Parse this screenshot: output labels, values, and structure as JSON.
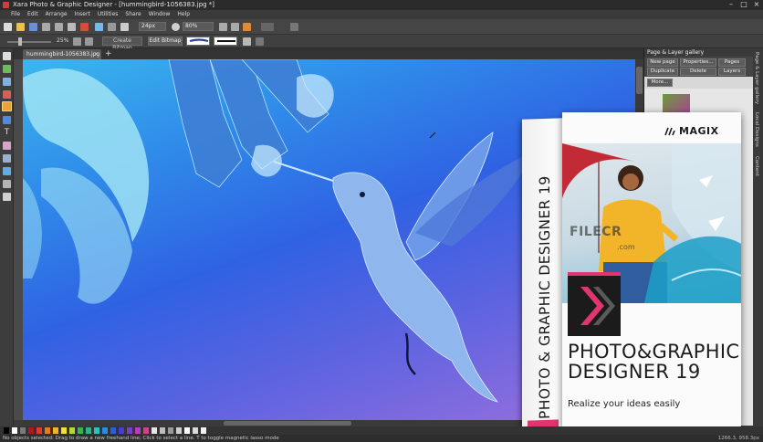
{
  "window": {
    "title": "Xara Photo & Graphic Designer - [hummingbird-1056383.jpg *]"
  },
  "menu": [
    "File",
    "Edit",
    "Arrange",
    "Insert",
    "Utilities",
    "Share",
    "Window",
    "Help"
  ],
  "toolbar": {
    "font_size": "24px",
    "zoom": "80%"
  },
  "toolbar2": {
    "opacity": "25%",
    "create_bitmap": "Create Bitmap",
    "edit_bitmap": "Edit Bitmap"
  },
  "document": {
    "tab_label": "hummingbird-1056383.jpg *",
    "close": "×",
    "new_tab": "+"
  },
  "gallery": {
    "title": "Page & Layer gallery",
    "buttons": [
      "New page",
      "Properties...",
      "Pages",
      "Duplicate",
      "Delete",
      "Layers"
    ],
    "more": "More..."
  },
  "side_tabs": [
    "Page & Layer gallery",
    "Local Designs",
    "Content"
  ],
  "status": {
    "text": "No objects selected: Drag to draw a new freehand line; Click to select a line. T to toggle magnetic lasso mode",
    "coords": "1266.3, 958.3px"
  },
  "box": {
    "brand": "MAGIX",
    "side_text": "PHOTO & GRAPHIC DESIGNER 19",
    "title_line1": "PHOTO&GRAPHIC",
    "title_line2": "DESIGNER 19",
    "tagline": "Realize your ideas easily"
  },
  "watermark": {
    "text": "FILECR",
    "domain": ".com"
  },
  "colors": {
    "accent": "#e0356e",
    "canvas_top": "#3ab7ee",
    "canvas_bottom": "#9c70de"
  },
  "palette": [
    "#000000",
    "#ffffff",
    "#7a7a7a",
    "#b31717",
    "#e03a2a",
    "#e87a22",
    "#f0b62a",
    "#f3e12f",
    "#b5d92c",
    "#3fb24a",
    "#2db58a",
    "#2dbfc2",
    "#2c8fd6",
    "#2f5fd2",
    "#4b3fc7",
    "#7b3fc2",
    "#b13fbf",
    "#d13f8f",
    "#e6e6e6",
    "#bdbdbd",
    "#9a9a9a",
    "#cfcfcf",
    "#ffffff",
    "#d9d9d9",
    "#f2f2f2"
  ]
}
